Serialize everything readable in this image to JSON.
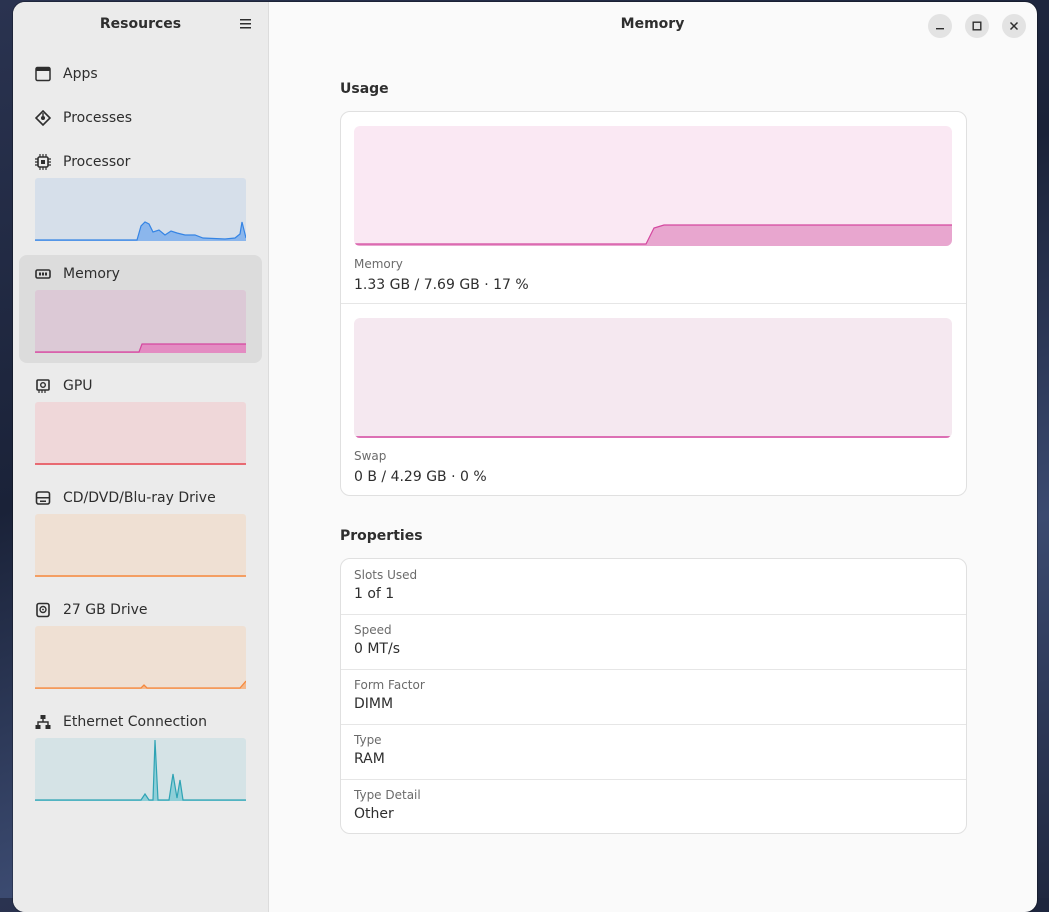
{
  "sidebar": {
    "title": "Resources",
    "items": [
      {
        "label": "Apps",
        "icon": "window-icon"
      },
      {
        "label": "Processes",
        "icon": "processes-icon"
      },
      {
        "label": "Processor",
        "icon": "cpu-icon",
        "color": "#3584e4",
        "bg": "#d6dfea"
      },
      {
        "label": "Memory",
        "icon": "memory-icon",
        "color": "#d4479f",
        "bg": "#dcc9d6"
      },
      {
        "label": "GPU",
        "icon": "gpu-icon",
        "color": "#e5454f",
        "bg": "#efd7d9"
      },
      {
        "label": "CD/DVD/Blu-ray Drive",
        "icon": "optical-drive-icon",
        "color": "#f5883d",
        "bg": "#efe0d3"
      },
      {
        "label": "27 GB Drive",
        "icon": "drive-icon",
        "color": "#f5883d",
        "bg": "#efe0d3"
      },
      {
        "label": "Ethernet Connection",
        "icon": "network-icon",
        "color": "#2ea3b4",
        "bg": "#d5e3e6"
      }
    ]
  },
  "main": {
    "title": "Memory",
    "usage_title": "Usage",
    "memory": {
      "caption": "Memory",
      "value": "1.33 GB / 7.69 GB · 17 %",
      "percent": 17
    },
    "swap": {
      "caption": "Swap",
      "value": "0 B / 4.29 GB · 0 %",
      "percent": 0
    },
    "properties_title": "Properties",
    "properties": [
      {
        "caption": "Slots Used",
        "value": "1 of 1"
      },
      {
        "caption": "Speed",
        "value": "0 MT/s"
      },
      {
        "caption": "Form Factor",
        "value": "DIMM"
      },
      {
        "caption": "Type",
        "value": "RAM"
      },
      {
        "caption": "Type Detail",
        "value": "Other"
      }
    ]
  },
  "colors": {
    "accent_memory": "#d4479f",
    "memory_fill": "#e8a6cf",
    "memory_bg": "#fae8f3",
    "swap_bg": "#f5e8f0"
  }
}
